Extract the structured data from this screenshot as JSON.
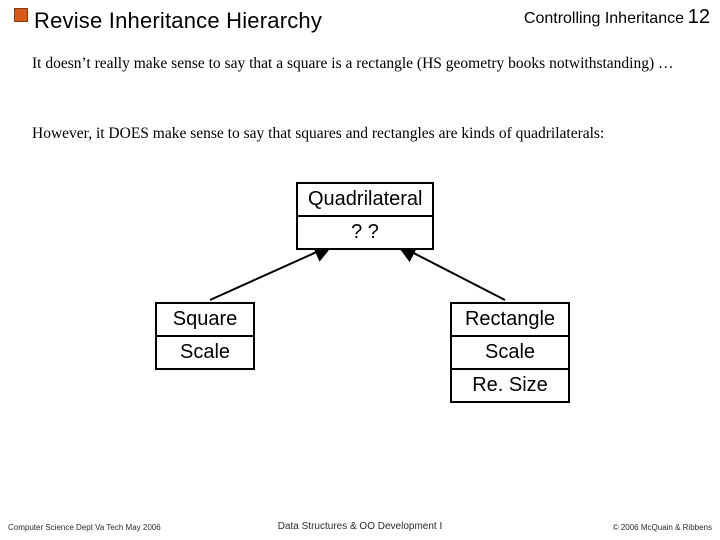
{
  "header": {
    "title": "Revise Inheritance Hierarchy",
    "topic": "Controlling Inheritance",
    "page_number": "12"
  },
  "body": {
    "p1": "It doesn’t really make sense to say that a square is a rectangle (HS geometry books notwithstanding) …",
    "p2": "However, it DOES make sense to say that squares and rectangles are kinds of quadrilaterals:"
  },
  "diagram": {
    "parent": {
      "name": "Quadrilateral",
      "mid": "? ?"
    },
    "left": {
      "name": "Square",
      "op1": "Scale"
    },
    "right": {
      "name": "Rectangle",
      "op1": "Scale",
      "op2": "Re. Size"
    }
  },
  "footer": {
    "left": "Computer Science Dept Va Tech May 2006",
    "center": "Data Structures & OO Development I",
    "right": "© 2006  McQuain & Ribbens"
  }
}
